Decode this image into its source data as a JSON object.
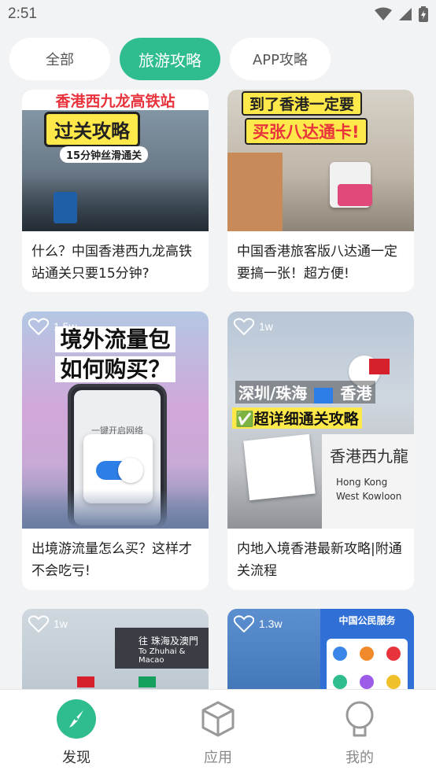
{
  "status": {
    "time": "2:51"
  },
  "tabs": [
    {
      "label": "全部",
      "active": false
    },
    {
      "label": "旅游攻略",
      "active": true
    },
    {
      "label": "APP攻略",
      "active": false
    }
  ],
  "feed": {
    "cards": [
      {
        "title": "什么？中国香港西九龙高铁站通关只要15分钟?",
        "image_text": [
          "香港西九龙高铁站",
          "过关攻略",
          "15分钟丝滑通关"
        ],
        "likes": ""
      },
      {
        "title": "中国香港旅客版八达通一定要搞一张！超方便!",
        "image_text": [
          "到了香港一定要",
          "买张八达通卡!"
        ],
        "likes": ""
      },
      {
        "title": "出境游流量怎么买？这样才不会吃亏!",
        "image_text": [
          "境外流量包",
          "如何购买？",
          "一键开启网络"
        ],
        "likes": "1.5w"
      },
      {
        "title": "内地入境香港最新攻略|附通关流程",
        "image_text": [
          "深圳/珠海",
          "香港",
          "✅超详细通关攻略",
          "香港西九龍",
          "Hong Kong",
          "West Kowloon"
        ],
        "likes": "1w"
      },
      {
        "title": "",
        "image_text": [
          "往 珠海及澳門",
          "To Zhuhai & Macao"
        ],
        "likes": "1w"
      },
      {
        "title": "",
        "image_text": [
          "中国公民服务"
        ],
        "likes": "1.3w"
      }
    ]
  },
  "bottom_nav": [
    {
      "label": "发现",
      "icon": "compass-icon",
      "active": true
    },
    {
      "label": "应用",
      "icon": "cube-icon",
      "active": false
    },
    {
      "label": "我的",
      "icon": "user-icon",
      "active": false
    }
  ],
  "colors": {
    "accent": "#2fbd8f",
    "background": "#f2f3f5"
  }
}
